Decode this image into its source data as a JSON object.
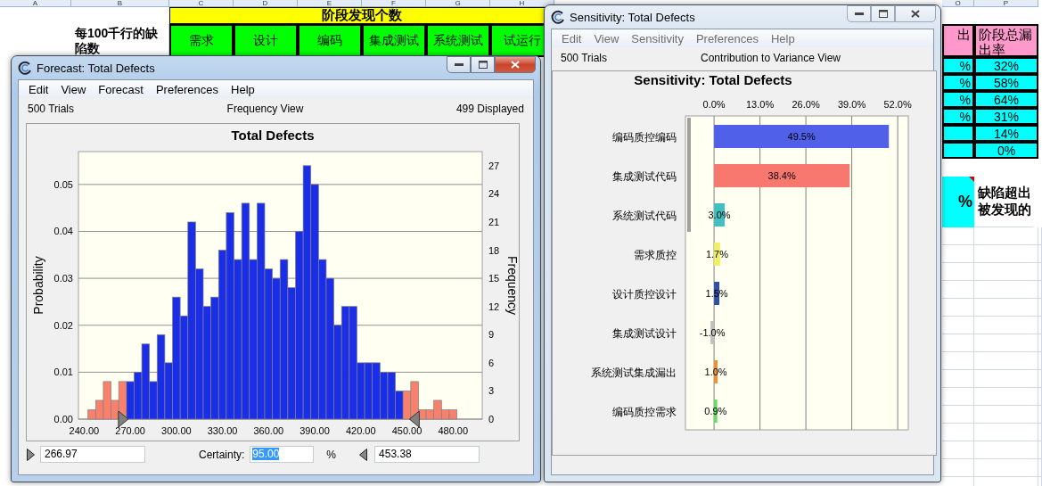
{
  "sheet": {
    "column_headers": [
      "A",
      "B",
      "C",
      "D",
      "E",
      "F",
      "G",
      "H",
      "O",
      "P"
    ],
    "stage_header": "阶段发现个数",
    "row_label": "每100千行的缺陷数",
    "stages": [
      "需求",
      "设计",
      "编码",
      "集成测试",
      "系统测试",
      "试运行"
    ],
    "leak_header": "出",
    "total_leak_header": "阶段总漏出率",
    "leak_cells": [
      "%",
      "%",
      "%",
      "%"
    ],
    "total_leak_rates": [
      "32%",
      "58%",
      "64%",
      "31%",
      "14%",
      "0%"
    ],
    "summary_value": "%",
    "summary_note": "缺陷超出被发现的"
  },
  "forecast": {
    "title": "Forecast: Total Defects",
    "active": true,
    "menu": [
      "Edit",
      "View",
      "Forecast",
      "Preferences",
      "Help"
    ],
    "trials": "500 Trials",
    "view": "Frequency View",
    "displayed": "499 Displayed",
    "left_axis": {
      "label": "Probability",
      "ticks": [
        "0.05",
        "0.04",
        "0.03",
        "0.02",
        "0.01",
        "0.00"
      ]
    },
    "chart_data": {
      "type": "bar",
      "title": "Total Defects",
      "ylabel": "Frequency",
      "x": [
        245,
        250,
        255,
        260,
        265,
        270,
        275,
        280,
        285,
        290,
        295,
        300,
        305,
        310,
        315,
        320,
        325,
        330,
        335,
        340,
        345,
        350,
        355,
        360,
        365,
        370,
        375,
        380,
        385,
        390,
        395,
        400,
        405,
        410,
        415,
        420,
        425,
        430,
        435,
        440,
        445,
        450,
        455,
        460,
        465,
        470,
        475,
        480
      ],
      "series": [
        {
          "color": "#1a2ee8",
          "values": [
            null,
            null,
            null,
            null,
            null,
            4,
            5,
            8,
            4,
            9,
            6,
            13,
            11,
            21,
            16,
            12,
            13,
            18,
            22,
            17,
            23,
            17,
            23,
            16,
            15,
            17,
            14,
            20,
            27,
            25,
            17,
            15,
            10,
            12,
            12,
            6,
            6,
            6,
            5,
            5,
            3,
            null,
            null,
            null,
            null,
            null,
            null,
            null
          ]
        },
        {
          "color": "#f8806c",
          "values": [
            1,
            2,
            4,
            2,
            4,
            null,
            null,
            null,
            null,
            null,
            null,
            null,
            null,
            null,
            null,
            null,
            null,
            null,
            null,
            null,
            null,
            null,
            null,
            null,
            null,
            null,
            null,
            null,
            null,
            null,
            null,
            null,
            null,
            null,
            null,
            null,
            null,
            null,
            null,
            null,
            null,
            3,
            4,
            1,
            1,
            2,
            1,
            1
          ]
        }
      ],
      "xlim": [
        236.3,
        499
      ],
      "ylim": [
        0,
        28.5
      ],
      "xticks": [
        {
          "value": 240,
          "label": "240.00"
        },
        {
          "value": 270,
          "label": "270.00"
        },
        {
          "value": 300,
          "label": "300.00"
        },
        {
          "value": 330,
          "label": "330.00"
        },
        {
          "value": 360,
          "label": "360.00"
        },
        {
          "value": 390,
          "label": "390.00"
        },
        {
          "value": 420,
          "label": "420.00"
        },
        {
          "value": 450,
          "label": "450.00"
        },
        {
          "value": 480,
          "label": "480.00"
        }
      ],
      "yticks": [
        0,
        3,
        6,
        9,
        12,
        15,
        18,
        21,
        24,
        27
      ],
      "grid": true
    },
    "lower_value": "266.97",
    "certainty_label": "Certainty:",
    "certainty": "95.00",
    "percent": "%",
    "upper_value": "453.38"
  },
  "sensitivity": {
    "title": "Sensitivity: Total Defects",
    "active": false,
    "menu": [
      "Edit",
      "View",
      "Sensitivity",
      "Preferences",
      "Help"
    ],
    "trials": "500 Trials",
    "view": "Contribution to Variance View",
    "chart_data": {
      "type": "bar",
      "orientation": "horizontal",
      "title": "Sensitivity: Total Defects",
      "categories": [
        "编码质控编码",
        "集成测试代码",
        "系统测试代码",
        "需求质控",
        "设计质控设计",
        "集成测试设计",
        "系统测试集成漏出",
        "编码质控需求"
      ],
      "series": [
        {
          "values": [
            49.5,
            38.4,
            3.0,
            1.7,
            1.5,
            -1.0,
            1.0,
            0.9
          ]
        }
      ],
      "colors": [
        "#5060e8",
        "#f87870",
        "#40c0c0",
        "#f0f060",
        "#3050a8",
        "#c0c0c0",
        "#f09030",
        "#60e060"
      ],
      "xlim": [
        -8.1,
        55
      ],
      "xticks": [
        {
          "value": 0,
          "label": "0.0%"
        },
        {
          "value": 13,
          "label": "13.0%"
        },
        {
          "value": 26,
          "label": "26.0%"
        },
        {
          "value": 39,
          "label": "39.0%"
        },
        {
          "value": 52,
          "label": "52.0%"
        }
      ],
      "grid": true,
      "value_labels": [
        "49.5%",
        "38.4%",
        "3.0%",
        "1.7%",
        "1.5%",
        "-1.0%",
        "1.0%",
        "0.9%"
      ]
    }
  }
}
